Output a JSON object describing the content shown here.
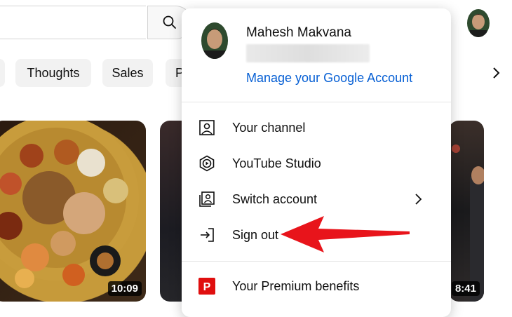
{
  "header": {
    "search": {
      "value": "",
      "placeholder": ""
    },
    "icons": {
      "search": "search-icon",
      "mic": "mic-icon"
    }
  },
  "chips": [
    {
      "label": ""
    },
    {
      "label": "Thoughts"
    },
    {
      "label": "Sales"
    },
    {
      "label": "P"
    }
  ],
  "videos": [
    {
      "duration": "10:09"
    },
    {
      "duration": ""
    },
    {
      "duration": "8:41"
    }
  ],
  "account_menu": {
    "name": "Mahesh Makvana",
    "manage_link": "Manage your Google Account",
    "items": [
      {
        "label": "Your channel",
        "icon": "person-box-icon"
      },
      {
        "label": "YouTube Studio",
        "icon": "studio-icon"
      },
      {
        "label": "Switch account",
        "icon": "switch-account-icon"
      },
      {
        "label": "Sign out",
        "icon": "sign-out-icon"
      },
      {
        "label": "Your Premium benefits",
        "icon": "premium-icon"
      }
    ]
  },
  "colors": {
    "link": "#065fd4",
    "premium": "#e00f0f",
    "annotation_arrow": "#e8141b"
  }
}
